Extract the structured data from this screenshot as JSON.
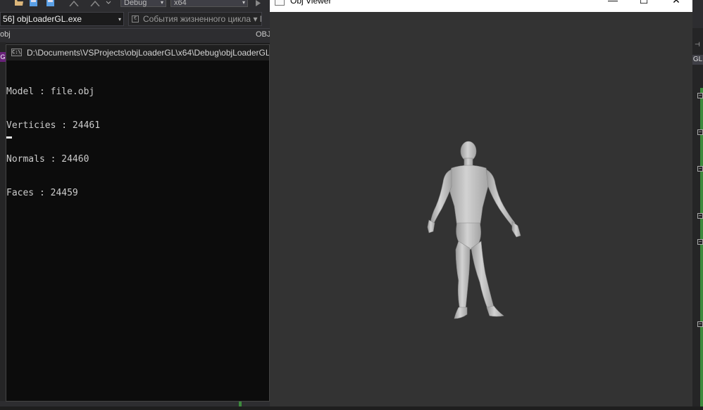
{
  "vs": {
    "debug_config": "Debug",
    "platform": "x64",
    "process": "56] objLoaderGL.exe",
    "lifecycle_events": "События жизненного цикла",
    "lifecycle_extra": "▾ П",
    "tab_fragment": "obj",
    "obj_fragment": "OBJ",
    "gl_label": "GL",
    "g_fragment": "G",
    "collapse_glyph": "−"
  },
  "console": {
    "title": "D:\\Documents\\VSProjects\\objLoaderGL\\x64\\Debug\\objLoaderGL.exe",
    "icon_text": "C:\\",
    "lines": [
      "Model : file.obj",
      "Verticies : 24461",
      "Normals : 24460",
      "Faces : 24459"
    ]
  },
  "viewer": {
    "title": "Obj Viewer",
    "minimize": "—",
    "maximize": "☐",
    "close": "✕",
    "background_color": "#333333",
    "model_color": "#bdbdbd"
  }
}
